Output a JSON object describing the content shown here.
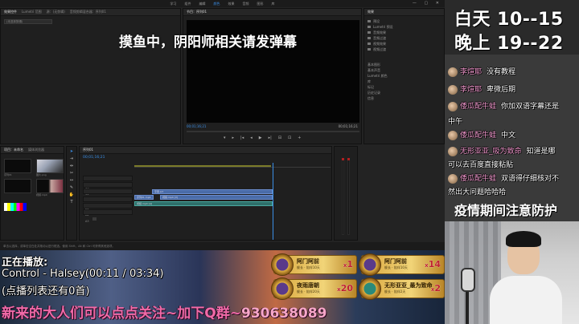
{
  "premiere": {
    "menu": [
      "学习",
      "组件",
      "编辑",
      "颜色",
      "效果",
      "音频",
      "图形",
      "库"
    ],
    "active_menu": "颜色",
    "source_tabs": [
      "效果控件",
      "Lumetri 范围",
      "源：(无剪辑)",
      "音频剪辑混合器：序列01"
    ],
    "source_field": "(未选择剪辑)",
    "program_tab": "节目：序列01",
    "program_timecode": "00;01;16;21",
    "program_fit": "适合",
    "program_duration": "00;01;16;21",
    "effects_tab": "效果",
    "effects_tree": [
      "预设",
      "Lumetri 预设",
      "音频效果",
      "音频过渡",
      "视频效果",
      "视频过渡"
    ],
    "effects_sections": [
      "基本图形",
      "基本声音",
      "Lumetri 颜色",
      "库",
      "标记",
      "历史记录",
      "信息"
    ],
    "project_tabs": [
      "项目：未命名",
      "媒体浏览器"
    ],
    "project_items": [
      "序列01",
      "图片.png",
      "视频.mp4"
    ],
    "timeline_tab": "序列01",
    "timeline_timecode": "00;01;16;21",
    "tracks": [
      "V3",
      "V2",
      "V1",
      "A1",
      "A2",
      "A3"
    ],
    "clips": {
      "v2": "字幕.srt",
      "v1_left": "序列01.mp4",
      "v1_right": "视频.mp4 [V]",
      "a1": "视频.mp4 [A]"
    },
    "status_text": "单击以选择，或单击空白处并拖动以进行框选。使用 Shift、Alt 和 Ctrl 可获得其他选项。"
  },
  "overlay": {
    "banner": "摸鱼中，阴阳师相关请发弹幕"
  },
  "schedule": {
    "day": "白天 10--15",
    "night": "晚上 19--22"
  },
  "danmaku": [
    {
      "user": "",
      "text": ""
    },
    {
      "user": "李煊耶",
      "text": "没有教程"
    },
    {
      "user": "李煊耶",
      "text": "卑微后期"
    },
    {
      "user": "倭瓜配牛蛙",
      "text": "你加双语字幕还是"
    },
    {
      "user": "",
      "text": "中午"
    },
    {
      "user": "倭瓜配牛蛙",
      "text": "中文"
    },
    {
      "user": "无形亚亚_吸为致命",
      "text": "知道是哪"
    },
    {
      "user": "",
      "text": "可以去百度直接粘贴"
    },
    {
      "user": "倭瓜配牛蛙",
      "text": "双语得仔细核对不"
    },
    {
      "user": "",
      "text": "然出大问题哈哈哈"
    }
  ],
  "warning": "疫情期间注意防护",
  "music": {
    "label": "正在播放:",
    "track": "Control - Halsey(00:11 / 03:34)",
    "queue": "(点播列表还有0首)"
  },
  "follow": {
    "text": "新来的大人们可以点点关注~加下Q群~",
    "qq": "930638089"
  },
  "guards": [
    {
      "name": "阿门阿前",
      "sub": "舰长 · 陪伴10天",
      "count": "1"
    },
    {
      "name": "阿门阿前",
      "sub": "舰长 · 陪伴10天",
      "count": "14"
    },
    {
      "name": "夜雨唐朝",
      "sub": "舰长 · 陪伴20天",
      "count": "20"
    },
    {
      "name": "无形亚亚_最为致命",
      "sub": "舰长 · 陪伴2天",
      "count": "2"
    }
  ],
  "colors": {
    "accent_blue": "#3a8ee6",
    "danmaku_name": "#f59ad0",
    "follow_pink": "#f06aa8"
  }
}
